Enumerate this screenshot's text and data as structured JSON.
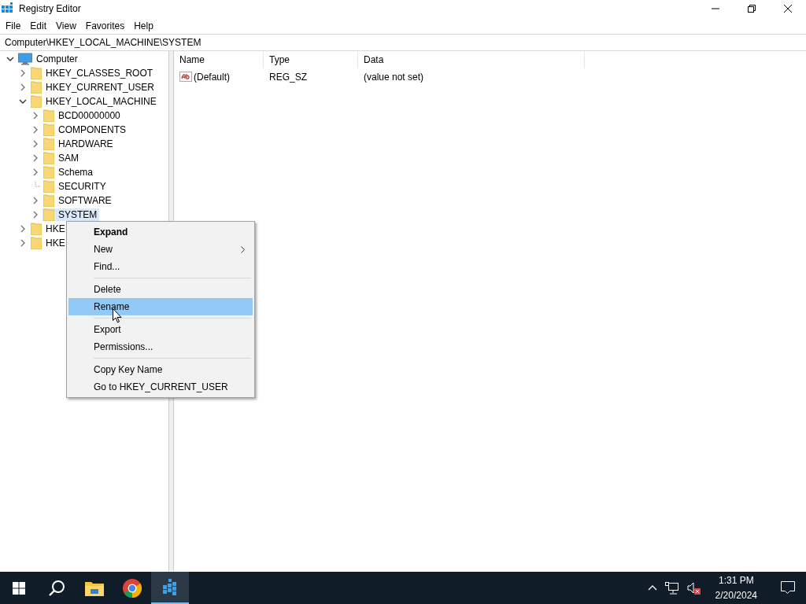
{
  "window": {
    "title": "Registry Editor"
  },
  "menu_bar": [
    "File",
    "Edit",
    "View",
    "Favorites",
    "Help"
  ],
  "address": "Computer\\HKEY_LOCAL_MACHINE\\SYSTEM",
  "tree": [
    {
      "label": "Computer",
      "kind": "computer",
      "expandable": true,
      "expanded": true,
      "selected": false,
      "children": [
        {
          "label": "HKEY_CLASSES_ROOT",
          "kind": "folder",
          "expandable": true,
          "selected": false
        },
        {
          "label": "HKEY_CURRENT_USER",
          "kind": "folder",
          "expandable": true,
          "selected": false
        },
        {
          "label": "HKEY_LOCAL_MACHINE",
          "kind": "folder",
          "expandable": true,
          "expanded": true,
          "selected": false,
          "children": [
            {
              "label": "BCD00000000",
              "kind": "folder",
              "expandable": true,
              "selected": false
            },
            {
              "label": "COMPONENTS",
              "kind": "folder",
              "expandable": true,
              "selected": false
            },
            {
              "label": "HARDWARE",
              "kind": "folder",
              "expandable": true,
              "selected": false
            },
            {
              "label": "SAM",
              "kind": "folder",
              "expandable": true,
              "selected": false
            },
            {
              "label": "Schema",
              "kind": "folder",
              "expandable": true,
              "selected": false
            },
            {
              "label": "SECURITY",
              "kind": "folder",
              "expandable": false,
              "selected": false
            },
            {
              "label": "SOFTWARE",
              "kind": "folder",
              "expandable": true,
              "selected": false
            },
            {
              "label": "SYSTEM",
              "kind": "folder",
              "expandable": true,
              "selected": true
            }
          ]
        },
        {
          "label": "HKE",
          "kind": "folder",
          "expandable": true,
          "selected": false
        },
        {
          "label": "HKE",
          "kind": "folder",
          "expandable": true,
          "selected": false
        }
      ]
    }
  ],
  "table": {
    "columns": [
      "Name",
      "Type",
      "Data"
    ],
    "rows": [
      {
        "name": "(Default)",
        "type": "REG_SZ",
        "data": "(value not set)"
      }
    ]
  },
  "context_menu": [
    {
      "kind": "item",
      "label": "Expand",
      "default": true,
      "submenu": false,
      "selected": false
    },
    {
      "kind": "item",
      "label": "New",
      "default": false,
      "submenu": true,
      "selected": false
    },
    {
      "kind": "item",
      "label": "Find...",
      "default": false,
      "submenu": false,
      "selected": false
    },
    {
      "kind": "separator"
    },
    {
      "kind": "item",
      "label": "Delete",
      "default": false,
      "submenu": false,
      "selected": false
    },
    {
      "kind": "item",
      "label": "Rename",
      "default": false,
      "submenu": false,
      "selected": true
    },
    {
      "kind": "separator"
    },
    {
      "kind": "item",
      "label": "Export",
      "default": false,
      "submenu": false,
      "selected": false
    },
    {
      "kind": "item",
      "label": "Permissions...",
      "default": false,
      "submenu": false,
      "selected": false
    },
    {
      "kind": "separator"
    },
    {
      "kind": "item",
      "label": "Copy Key Name",
      "default": false,
      "submenu": false,
      "selected": false
    },
    {
      "kind": "item",
      "label": "Go to HKEY_CURRENT_USER",
      "default": false,
      "submenu": false,
      "selected": false
    }
  ],
  "taskbar": {
    "apps": [
      {
        "kind": "start",
        "active": false
      },
      {
        "kind": "search",
        "active": false
      },
      {
        "kind": "explorer",
        "active": false
      },
      {
        "kind": "browser",
        "active": false
      },
      {
        "kind": "regedit",
        "active": true
      }
    ],
    "time": "1:31 PM",
    "date": "2/20/2024"
  }
}
